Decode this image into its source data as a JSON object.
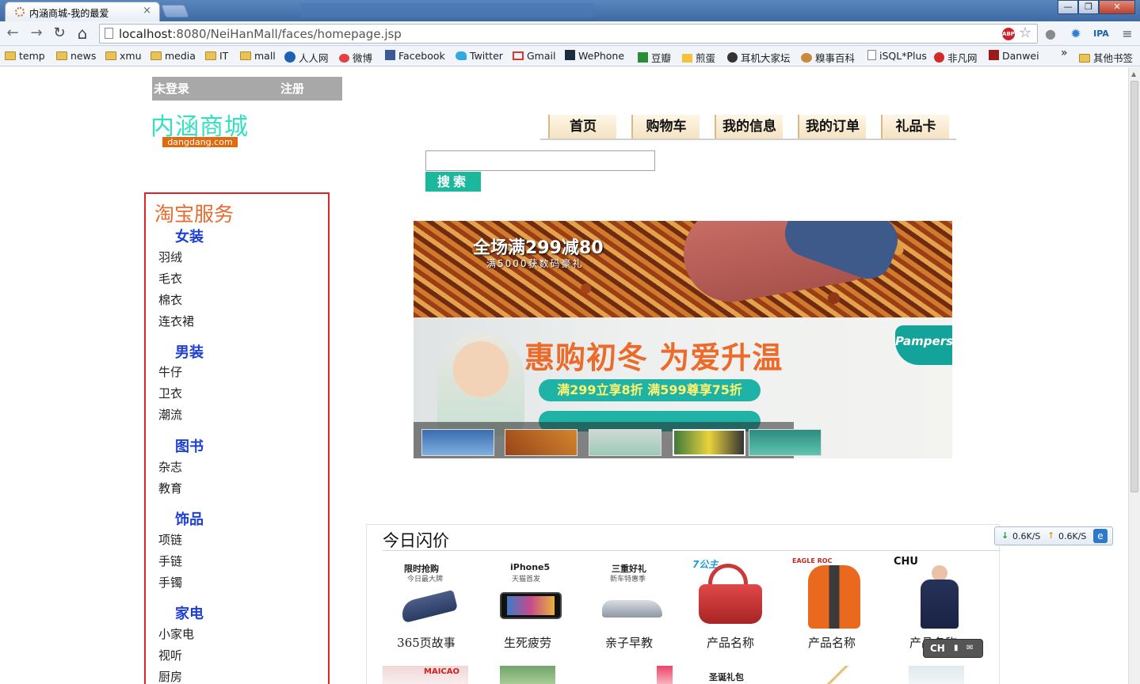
{
  "browser": {
    "tab_title": "内涵商城-我的最爱",
    "tab_close": "×",
    "url_host": "localhost",
    "url_rest": ":8080/NeiHanMall/faces/homepage.jsp",
    "abp": "ABP",
    "window_buttons": [
      "—",
      "❐",
      "✕"
    ],
    "nav_glyphs": {
      "back": "←",
      "forward": "→",
      "reload": "↻",
      "home": "⌂",
      "star": "☆",
      "menu": "≡"
    },
    "bookmarks": [
      {
        "label": "temp",
        "icon": "folder-icon"
      },
      {
        "label": "news",
        "icon": "folder-icon"
      },
      {
        "label": "xmu",
        "icon": "folder-icon"
      },
      {
        "label": "media",
        "icon": "folder-icon"
      },
      {
        "label": "IT",
        "icon": "folder-icon"
      },
      {
        "label": "mall",
        "icon": "folder-icon"
      },
      {
        "label": "人人网",
        "icon": "renren-icon"
      },
      {
        "label": "微博",
        "icon": "weibo-icon"
      },
      {
        "label": "Facebook",
        "icon": "facebook-icon"
      },
      {
        "label": "Twitter",
        "icon": "twitter-icon"
      },
      {
        "label": "Gmail",
        "icon": "gmail-icon"
      },
      {
        "label": "WePhone",
        "icon": "wephone-icon"
      },
      {
        "label": "豆瓣",
        "icon": "douban-icon"
      },
      {
        "label": "煎蛋",
        "icon": "jiandan-icon"
      },
      {
        "label": "耳机大家坛",
        "icon": "erji-icon"
      },
      {
        "label": "糗事百科",
        "icon": "qiushi-icon"
      },
      {
        "label": "iSQL*Plus",
        "icon": "page-icon"
      },
      {
        "label": "非凡网",
        "icon": "feifan-icon"
      },
      {
        "label": "Danwei",
        "icon": "danwei-icon"
      }
    ],
    "more_chevron": "»",
    "other_bookmarks": "其他书签"
  },
  "header": {
    "login": "未登录",
    "register": "注册",
    "logo": "内涵商城",
    "logo_sub": "dangdang.com"
  },
  "nav": [
    "首页",
    "购物车",
    "我的信息",
    "我的订单",
    "礼品卡"
  ],
  "search": {
    "placeholder": "",
    "button": "搜索"
  },
  "sidebar": {
    "title": "淘宝服务",
    "categories": [
      {
        "name": "女装",
        "items": [
          "羽绒",
          "毛衣",
          "棉衣",
          "连衣裙"
        ]
      },
      {
        "name": "男装",
        "items": [
          "牛仔",
          "卫衣",
          "潮流"
        ]
      },
      {
        "name": "图书",
        "items": [
          "杂志",
          "教育"
        ]
      },
      {
        "name": "饰品",
        "items": [
          "项链",
          "手链",
          "手镯"
        ]
      },
      {
        "name": "家电",
        "items": [
          "小家电",
          "视听",
          "厨房"
        ]
      }
    ]
  },
  "banner": {
    "top_headline": "全场满299减80",
    "top_sub": "满5000获数码豪礼",
    "main_headline": "惠购初冬 为爱升温",
    "pill": "满299立享8折 满599尊享75折",
    "brand": "Pampers"
  },
  "deals": {
    "title": "今日闪价",
    "products": [
      {
        "name": "365页故事",
        "tag": "限时抢购",
        "tag_sub": "今日最大牌",
        "img": "shoe"
      },
      {
        "name": "生死疲劳",
        "tag": "iPhone5",
        "tag_sub": "天猫首发",
        "img": "phone"
      },
      {
        "name": "亲子早教",
        "tag": "三重好礼",
        "tag_sub": "新车特惠季",
        "img": "car"
      },
      {
        "name": "产品名称",
        "tag": "7公主",
        "tag_sub": "",
        "img": "bag"
      },
      {
        "name": "产品名称",
        "tag": "EAGLE ROC",
        "tag_sub": "",
        "img": "jacket"
      },
      {
        "name": "产品名称",
        "tag": "CHU",
        "tag_sub": "",
        "img": "coat"
      }
    ],
    "row2_tags": [
      "MAICAO",
      "",
      "",
      "圣诞礼包",
      "",
      ""
    ]
  },
  "overlays": {
    "net_down": "0.6K/S",
    "net_up": "0.6K/S",
    "ime": "CH"
  },
  "colors": {
    "logo": "#33e0c0",
    "category": "#1d3fd6",
    "sidebar_border": "#dc2626",
    "search_button": "#1bb89e",
    "sidebar_title": "#e86a2c"
  }
}
